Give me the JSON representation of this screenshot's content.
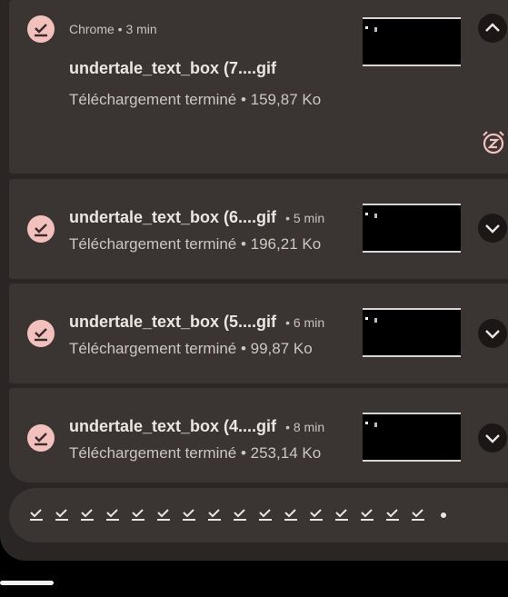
{
  "notifications": [
    {
      "app": "Chrome",
      "time": "3 min",
      "app_line": "Chrome • 3 min",
      "filename": "undertale_text_box (7....gif",
      "status": "Téléchargement terminé • 159,87 Ko",
      "expanded": true
    },
    {
      "filename": "undertale_text_box (6....gif",
      "time_label": "• 5 min",
      "status": "Téléchargement terminé • 196,21 Ko",
      "expanded": false
    },
    {
      "filename": "undertale_text_box (5....gif",
      "time_label": "• 6 min",
      "status": "Téléchargement terminé • 99,87 Ko",
      "expanded": false
    },
    {
      "filename": "undertale_text_box (4....gif",
      "time_label": "• 8 min",
      "status": "Téléchargement terminé • 253,14 Ko",
      "expanded": false
    }
  ],
  "icons": {
    "download": "download-done-icon",
    "collapse": "chevron-up-icon",
    "expand": "chevron-down-icon",
    "snooze": "snooze-icon"
  },
  "colors": {
    "icon_bg": "#f3c1bd",
    "card_bg": "#3a3533",
    "panel_bg": "#2a2625"
  }
}
